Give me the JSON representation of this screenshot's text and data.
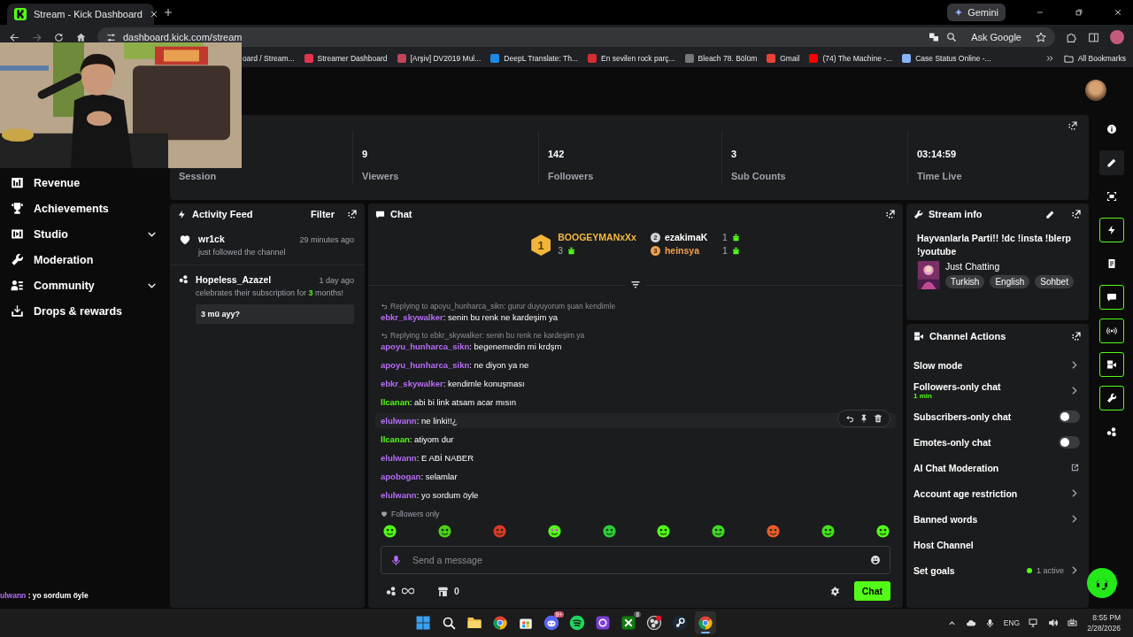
{
  "browser": {
    "tab_title": "Stream - Kick Dashboard",
    "gemini": "Gemini",
    "url": "dashboard.kick.com/stream",
    "ask_google": "Ask Google",
    "bookmarks": [
      {
        "label": "oard / Stream..."
      },
      {
        "label": "Streamer Dashboard",
        "kind": "star"
      },
      {
        "label": "[Arşiv] DV2019 Mul...",
        "kind": "archive"
      },
      {
        "label": "DeepL Translate: Th...",
        "kind": "prompt"
      },
      {
        "label": "En sevilen rock parç...",
        "kind": "badge"
      },
      {
        "label": "Bleach 78. Bölüm",
        "kind": "shield"
      },
      {
        "label": "Gmail",
        "kind": "mail"
      },
      {
        "label": "(74) The Machine -...",
        "kind": "video"
      },
      {
        "label": "Case Status Online -...",
        "kind": "globe"
      }
    ],
    "all_bookmarks": "All Bookmarks"
  },
  "overlay": {
    "chat_user": "ulwann",
    "chat_text": " : yo sordum öyle"
  },
  "sidebar": {
    "items": [
      {
        "label": "Revenue",
        "kind": "revenue",
        "expandable": false
      },
      {
        "label": "Achievements",
        "kind": "trophy",
        "expandable": false
      },
      {
        "label": "Studio",
        "kind": "studio",
        "expandable": true
      },
      {
        "label": "Moderation",
        "kind": "wrench",
        "expandable": false
      },
      {
        "label": "Community",
        "kind": "people",
        "expandable": true
      },
      {
        "label": "Drops & rewards",
        "kind": "drops",
        "expandable": false
      }
    ]
  },
  "stats": [
    {
      "label": "Session"
    },
    {
      "value": "9",
      "label": "Viewers"
    },
    {
      "value": "142",
      "label": "Followers"
    },
    {
      "value": "3",
      "label": "Sub Counts"
    },
    {
      "value": "03:14:59",
      "label": "Time Live"
    }
  ],
  "activity_feed": {
    "title": "Activity Feed",
    "filter": "Filter",
    "items": [
      {
        "kind": "follow",
        "user": "wr1ck",
        "time": "29 minutes ago",
        "text": "just followed the channel"
      },
      {
        "kind": "subscription",
        "user": "Hopeless_Azazel",
        "time": "1 day ago",
        "text": "celebrates their subscription for **3** months!",
        "message": "3 mü ayy?"
      }
    ]
  },
  "chat": {
    "title": "Chat",
    "leaderboard": [
      {
        "rank": "1",
        "name": "BOOGEYMANxXx",
        "count": "3",
        "color": "#f5b942"
      },
      {
        "rank": "2",
        "name": "ezakimaK",
        "count": "1",
        "color": "#ffffff"
      },
      {
        "rank": "3",
        "name": "heinsya",
        "count": "1",
        "color": "#f0a050"
      }
    ],
    "messages": [
      {
        "reply": "Replying to apoyu_hunharca_sikn: gurur duyuyorum şuan kendimle",
        "user": "ebkr_skywalker",
        "color": "#b56cf6",
        "text": ": senin bu renk ne kardeşim ya",
        "hovered": false
      },
      {
        "reply": "Replying to ebkr_skywalker: senin bu renk ne kardeşim ya",
        "user": "apoyu_hunharca_sikn",
        "color": "#b56cf6",
        "text": ": begenemedin mi krdşm",
        "hovered": false
      },
      {
        "user": "apoyu_hunharca_sikn",
        "color": "#b56cf6",
        "text": ": ne diyon ya ne",
        "hovered": false
      },
      {
        "user": "ebkr_skywalker",
        "color": "#b56cf6",
        "text": ": kendimle konuşması",
        "hovered": false
      },
      {
        "user": "llcanan",
        "color": "#53fc18",
        "text": ": abi bi link atsam acar mısın",
        "hovered": false
      },
      {
        "user": "elulwann",
        "color": "#b56cf6",
        "text": ": ne linki!!¿",
        "hovered": true
      },
      {
        "user": "llcanan",
        "color": "#53fc18",
        "text": ": atiyom dur",
        "hovered": false
      },
      {
        "user": "elulwann",
        "color": "#b56cf6",
        "text": ": E ABİ NABER",
        "hovered": false
      },
      {
        "user": "apobogan",
        "color": "#b56cf6",
        "text": ": selamlar",
        "hovered": false
      },
      {
        "user": "elulwann",
        "color": "#b56cf6",
        "text": ": yo sordum öyle",
        "hovered": false
      }
    ],
    "mode": "Followers only",
    "placeholder": "Send a message",
    "points": "0",
    "send": "Chat"
  },
  "stream_info": {
    "title": "Stream info",
    "stream_title": "Hayvanlarla Parti!! !dc !insta !blerp !youtube",
    "category": "Just Chatting",
    "tags": [
      "Turkish",
      "English",
      "Sohbet"
    ]
  },
  "channel_actions": {
    "title": "Channel Actions",
    "items": [
      {
        "kind": "link",
        "label": "Slow mode"
      },
      {
        "kind": "link",
        "label": "Followers-only chat",
        "detail": "1 min"
      },
      {
        "kind": "toggle",
        "label": "Subscribers-only chat",
        "on": false
      },
      {
        "kind": "toggle",
        "label": "Emotes-only chat",
        "on": false
      },
      {
        "kind": "external",
        "label": "AI Chat Moderation"
      },
      {
        "kind": "link",
        "label": "Account age restriction"
      },
      {
        "kind": "link",
        "label": "Banned words"
      },
      {
        "kind": "plain",
        "label": "Host Channel"
      },
      {
        "kind": "link",
        "label": "Set goals",
        "status": "1 active"
      }
    ]
  },
  "rail": [
    {
      "kind": "info",
      "on": false,
      "hovered": false
    },
    {
      "kind": "edit",
      "on": false,
      "hovered": true
    },
    {
      "kind": "capture",
      "on": false,
      "hovered": false
    },
    {
      "kind": "bolt",
      "on": true,
      "hovered": false
    },
    {
      "kind": "notes",
      "on": false,
      "hovered": false
    },
    {
      "kind": "chat",
      "on": true,
      "hovered": false
    },
    {
      "kind": "broadcast",
      "on": true,
      "hovered": false
    },
    {
      "kind": "camera",
      "on": true,
      "hovered": false
    },
    {
      "kind": "wrench",
      "on": true,
      "hovered": false
    },
    {
      "kind": "dots",
      "on": false,
      "hovered": false
    }
  ],
  "taskbar": {
    "apps": [
      {
        "kind": "windows",
        "active": false
      },
      {
        "kind": "search",
        "active": false
      },
      {
        "kind": "folder",
        "active": false
      },
      {
        "kind": "chrome",
        "active": false
      },
      {
        "kind": "store",
        "active": false
      },
      {
        "kind": "discord",
        "active": false,
        "badge": "9+"
      },
      {
        "kind": "spotify",
        "active": false
      },
      {
        "kind": "app",
        "active": false
      },
      {
        "kind": "xbox",
        "active": false,
        "badge": "8"
      },
      {
        "kind": "obs",
        "active": false
      },
      {
        "kind": "steam",
        "active": false
      },
      {
        "kind": "chrome",
        "active": true
      }
    ],
    "lang": "ENG",
    "time": "8:55 PM",
    "date": "2/28/2026"
  }
}
